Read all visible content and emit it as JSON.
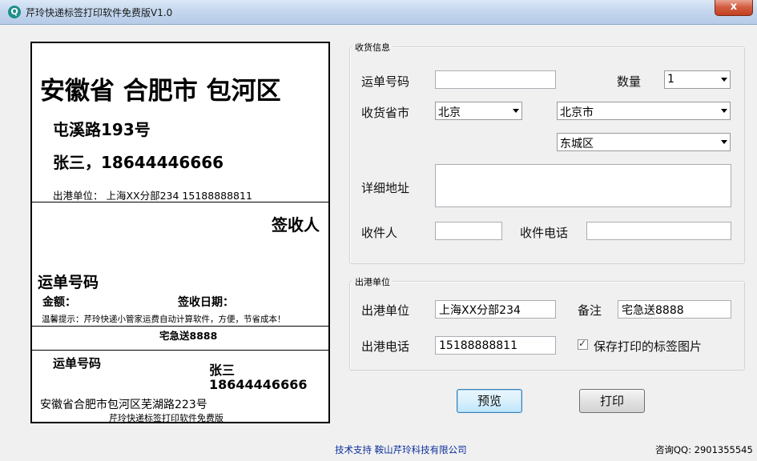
{
  "window": {
    "title": "芹玲快递标签打印软件免费版V1.0",
    "app_icon": "Q",
    "close_glyph": "x"
  },
  "label_preview": {
    "province_city_district": "安徽省 合肥市 包河区",
    "street": "屯溪路193号",
    "name_phone": "张三，18644446666",
    "origin": "出港单位：  上海XX分部234 15188888811",
    "sign": "签收人",
    "waybill_label": "运单号码",
    "amount_label": "金额：",
    "sign_date_label": "签收日期：",
    "tip": "温馨提示：芹玲快递小管家运费自动计算软件，方便，节省成本！",
    "courier": "宅急送8888",
    "waybill_label2": "运单号码",
    "name2": "张三",
    "phone2": "18644446666",
    "address2": "安徽省合肥市包河区芜湖路223号",
    "footer": "芹玲快递标签打印软件免费版"
  },
  "receive": {
    "legend": "收货信息",
    "waybill_label": "运单号码",
    "waybill_value": "",
    "quantity_label": "数量",
    "quantity_value": "1",
    "province_label": "收货省市",
    "province_value": "北京",
    "city_value": "北京市",
    "district_value": "东城区",
    "address_label": "详细地址",
    "address_value": "",
    "recipient_label": "收件人",
    "recipient_value": "",
    "phone_label": "收件电话",
    "phone_value": ""
  },
  "outbound": {
    "legend": "出港单位",
    "unit_label": "出港单位",
    "unit_value": "上海XX分部234",
    "note_label": "备注",
    "note_value": "宅急送8888",
    "phone_label": "出港电话",
    "phone_value": "15188888811",
    "save_image_label": "保存打印的标签图片",
    "save_image_checked": true
  },
  "buttons": {
    "preview": "预览",
    "print": "打印"
  },
  "footer": {
    "support": "技术支持  鞍山芹玲科技有限公司",
    "qq": "咨询QQ: 2901355545"
  },
  "colors": {
    "title_bar": "#c3d6ee",
    "close_button": "#c2401f",
    "link": "#0b2f9b"
  }
}
